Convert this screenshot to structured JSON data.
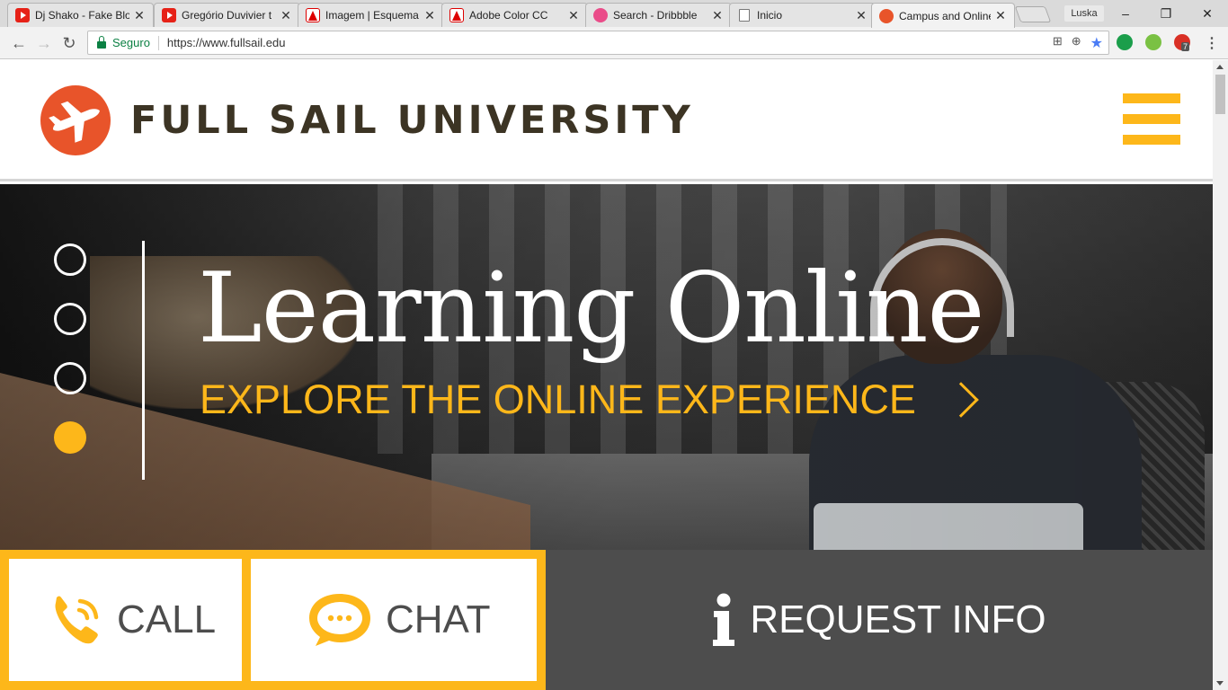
{
  "browser": {
    "tabs": [
      {
        "title": "Dj Shako - Fake Blo",
        "favicon": "youtube-icon"
      },
      {
        "title": "Gregório Duvivier t",
        "favicon": "youtube-icon"
      },
      {
        "title": "Imagem | Esquema",
        "favicon": "adobe-icon"
      },
      {
        "title": "Adobe Color CC",
        "favicon": "adobe-icon"
      },
      {
        "title": "Search - Dribbble",
        "favicon": "dribbble-icon"
      },
      {
        "title": "Inicio",
        "favicon": "document-icon"
      },
      {
        "title": "Campus and Online",
        "favicon": "fullsail-icon"
      }
    ],
    "active_tab": 6,
    "profile_name": "Luska",
    "security_label": "Seguro",
    "url": "https://www.fullsail.edu",
    "extension_badge": "7"
  },
  "site": {
    "brand_name": "FULL SAIL UNIVERSITY",
    "colors": {
      "brand_orange": "#e8542a",
      "accent_yellow": "#fdb71a",
      "dark_gray": "#4d4d4d"
    },
    "hero": {
      "title": "Learning Online",
      "cta": "EXPLORE THE ONLINE EXPERIENCE",
      "slide_count": 4,
      "active_slide": 4
    },
    "actions": {
      "call": "CALL",
      "chat": "CHAT",
      "request_info": "REQUEST INFO"
    }
  }
}
